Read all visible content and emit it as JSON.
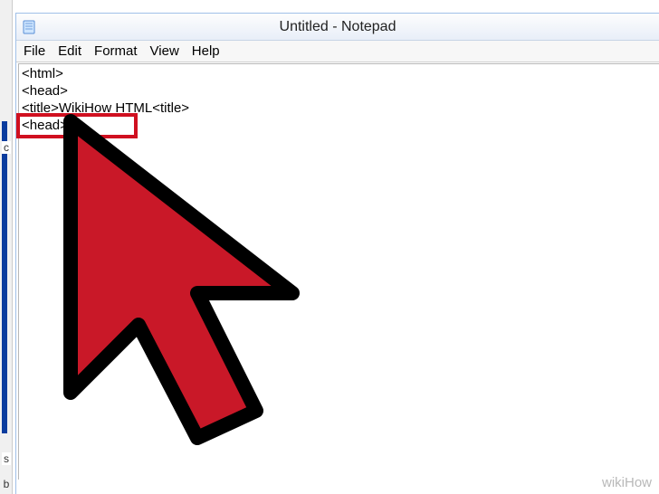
{
  "titlebar": {
    "title": "Untitled - Notepad"
  },
  "menubar": {
    "file": "File",
    "edit": "Edit",
    "format": "Format",
    "view": "View",
    "help": "Help"
  },
  "editor": {
    "line1": "<html>",
    "line2": "<head>",
    "line3_a": "<title>WikiHow ",
    "line3_b": "HTML<title>",
    "line4": "<head>"
  },
  "sidebar_chars": {
    "c": "c",
    "s": "s",
    "b": "b"
  },
  "watermark": "wikiHow",
  "colors": {
    "highlight": "#d01020",
    "cursor_fill": "#c91828",
    "cursor_stroke": "#000000"
  }
}
